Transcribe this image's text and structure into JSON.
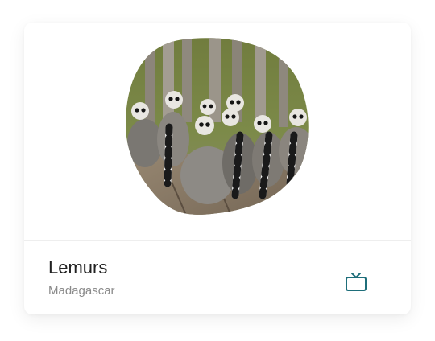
{
  "card": {
    "title": "Lemurs",
    "subtitle": "Madagascar",
    "image_subject": "group of ring-tailed lemurs on a wooden deck",
    "action_icon": "tv-icon",
    "accent_color": "#1e6e7a"
  }
}
